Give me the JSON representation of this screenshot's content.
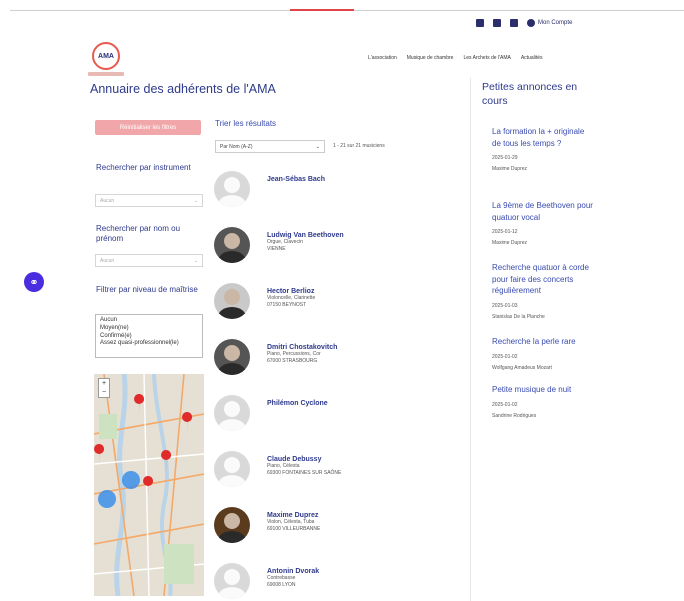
{
  "header": {
    "account_label": "Mon Compte",
    "logo_text": "AMA",
    "nav": [
      "L'association",
      "Musique de chambre",
      "Les Archets de l'AMA",
      "Actualités"
    ]
  },
  "page_title": "Annuaire des adhérents de l'AMA",
  "filters": {
    "reset_label": "Réinitialiser les filtres",
    "instrument_label": "Rechercher par instrument",
    "instrument_value": "Aucun",
    "name_label": "Rechercher par nom ou prénom",
    "name_value": "Aucun",
    "level_label": "Filtrer par niveau de maîtrise",
    "levels": [
      "Aucun",
      "Moyen(ne)",
      "Confirmé(e)",
      "Assez quasi-professionnel(le)"
    ]
  },
  "sort": {
    "label": "Trier les résultats",
    "value": "Par Nom (A-Z)",
    "count": "1 - 21 sur 21 musiciens"
  },
  "members": [
    {
      "name": "Jean-Sébas Bach",
      "instrument": "",
      "city": "",
      "photo": "none"
    },
    {
      "name": "Ludwig Van Beethoven",
      "instrument": "Orgue, Clavecin",
      "city": "VIENNE",
      "photo": "dark"
    },
    {
      "name": "Hector Berlioz",
      "instrument": "Violoncelle, Clarinette",
      "city": "07150 BEYNOST",
      "photo": "light"
    },
    {
      "name": "Dmitri Chostakovitch",
      "instrument": "Piano, Percussions, Cor",
      "city": "67000 STRASBOURG",
      "photo": "dark"
    },
    {
      "name": "Philémon Cyclone",
      "instrument": "",
      "city": "",
      "photo": "none"
    },
    {
      "name": "Claude Debussy",
      "instrument": "Piano, Célesta",
      "city": "69300 FONTAINES SUR SAÔNE",
      "photo": "none"
    },
    {
      "name": "Maxime Duprez",
      "instrument": "Violon, Célesta, Tuba",
      "city": "69100 VILLEURBANNE",
      "photo": "brown"
    },
    {
      "name": "Antonin Dvorak",
      "instrument": "Contrebasse",
      "city": "69008 LYON",
      "photo": "none"
    }
  ],
  "ads": {
    "title": "Petites annonces en cours",
    "items": [
      {
        "title": "La formation la + originale de tous les temps ?",
        "date": "2025-01-29",
        "author": "Maxime Duprez"
      },
      {
        "title": "La 9ème de Beethoven pour quatuor vocal",
        "date": "2025-01-12",
        "author": "Maxime Duprez"
      },
      {
        "title": "Recherche quatuor à corde pour faire des concerts régulièrement",
        "date": "2025-01-03",
        "author": "Stanislas De la Planche"
      },
      {
        "title": "Recherche la perle rare",
        "date": "2025-01-02",
        "author": "Wolfgang Amadeus Mozart"
      },
      {
        "title": "Petite musique de nuit",
        "date": "2025-01-02",
        "author": "Sandrine Rodrigues"
      }
    ]
  },
  "colors": {
    "accent": "#2e3a8c",
    "link": "#3a4bb0",
    "reset_button": "#f1a7a9",
    "floating_button": "#4b2de0",
    "marker_red": "#e02b2b",
    "cluster_blue": "#3b8ee8"
  }
}
